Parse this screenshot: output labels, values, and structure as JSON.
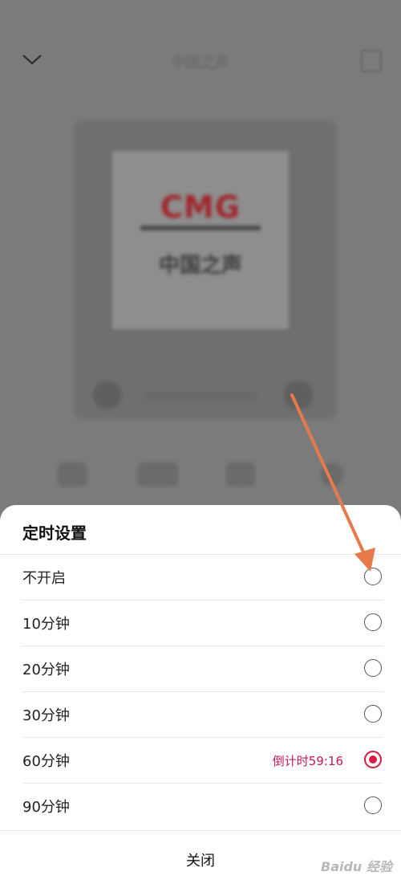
{
  "header": {
    "title": "中国之声"
  },
  "cover": {
    "logo_text": "CMG",
    "station_name": "中国之声"
  },
  "timer_sheet": {
    "title": "定时设置",
    "options": [
      {
        "label": "不开启",
        "selected": false,
        "countdown": ""
      },
      {
        "label": "10分钟",
        "selected": false,
        "countdown": ""
      },
      {
        "label": "20分钟",
        "selected": false,
        "countdown": ""
      },
      {
        "label": "30分钟",
        "selected": false,
        "countdown": ""
      },
      {
        "label": "60分钟",
        "selected": true,
        "countdown": "倒计时59:16"
      },
      {
        "label": "90分钟",
        "selected": false,
        "countdown": ""
      }
    ],
    "close_label": "关闭"
  },
  "colors": {
    "accent": "#d81b3f",
    "annotation_arrow": "#e8794a"
  },
  "icons": {
    "back": "chevron-down-icon",
    "menu": "menu-icon"
  },
  "watermark": {
    "text": "Baidu 经验"
  }
}
